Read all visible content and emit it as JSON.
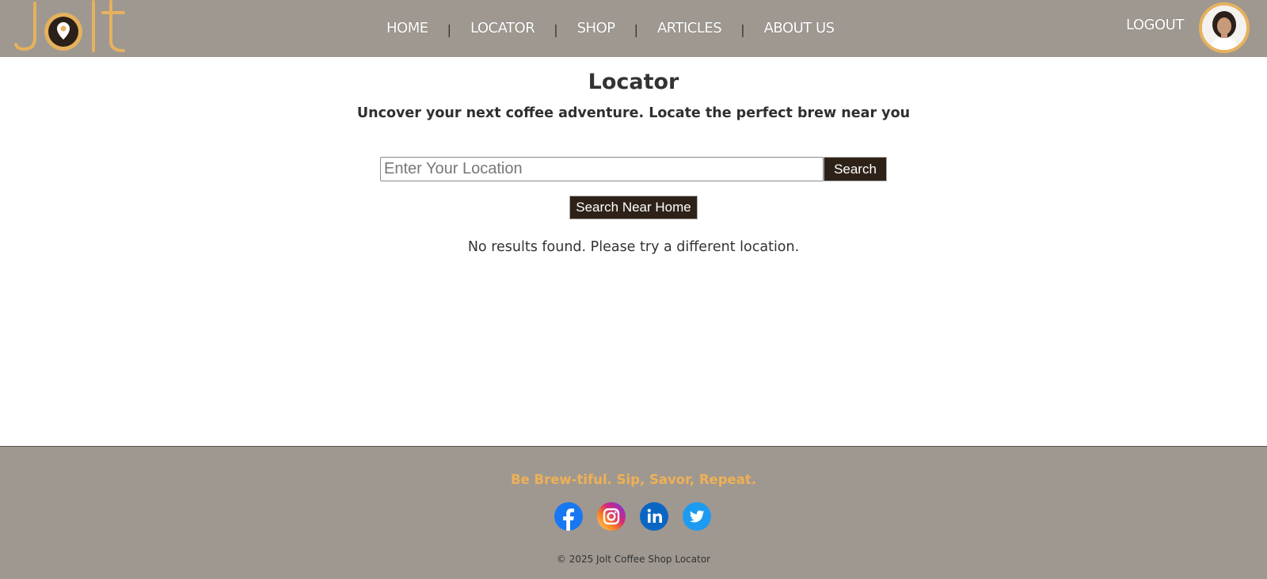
{
  "header": {
    "logo_text": "Jolt",
    "nav": [
      {
        "label": "HOME"
      },
      {
        "label": "LOCATOR"
      },
      {
        "label": "SHOP"
      },
      {
        "label": "ARTICLES"
      },
      {
        "label": "ABOUT US"
      }
    ],
    "nav_separator": "|",
    "logout_label": "LOGOUT",
    "avatar_icon": "user-avatar"
  },
  "main": {
    "title": "Locator",
    "subtitle": "Uncover your next coffee adventure. Locate the perfect brew near you",
    "search": {
      "placeholder": "Enter Your Location",
      "value": "",
      "button_label": "Search"
    },
    "near_home_label": "Search Near Home",
    "no_results_text": "No results found. Please try a different location."
  },
  "footer": {
    "tagline": "Be Brew-tiful. Sip, Savor, Repeat.",
    "socials": [
      "facebook-icon",
      "instagram-icon",
      "linkedin-icon",
      "twitter-icon"
    ],
    "copyright": "© 2025 Jolt Coffee Shop Locator"
  },
  "colors": {
    "header_bg": "#9e9890",
    "accent_gold": "#e6b15e",
    "button_bg": "#2e2218",
    "tagline": "#f0b055"
  }
}
